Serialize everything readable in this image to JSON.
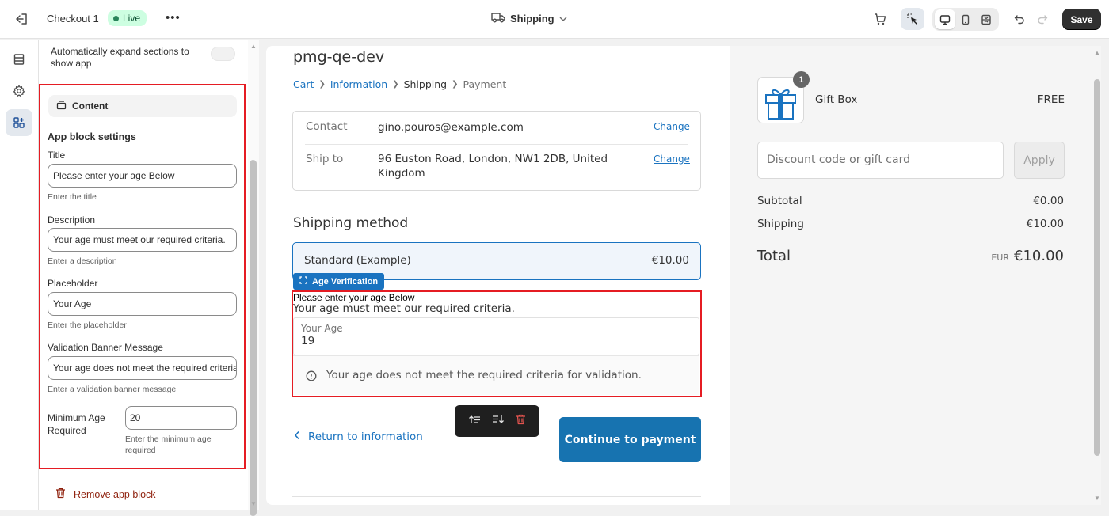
{
  "topbar": {
    "title": "Checkout 1",
    "status": "Live",
    "more": "•••",
    "page_selector": "Shipping",
    "save_label": "Save"
  },
  "panel": {
    "auto_expand_label": "Automatically expand sections to show app",
    "content_tab": "Content",
    "section_header": "App block settings",
    "fields": {
      "title": {
        "label": "Title",
        "value": "Please enter your age Below",
        "hint": "Enter the title"
      },
      "description": {
        "label": "Description",
        "value": "Your age must meet our required criteria.",
        "hint": "Enter a description"
      },
      "placeholder": {
        "label": "Placeholder",
        "value": "Your Age",
        "hint": "Enter the placeholder"
      },
      "validation": {
        "label": "Validation Banner Message",
        "value": "Your age does not meet the required criteria for validation.",
        "hint": "Enter a validation banner message"
      },
      "min_age": {
        "label": "Minimum Age Required",
        "value": "20",
        "hint": "Enter the minimum age required"
      }
    },
    "remove_label": "Remove app block"
  },
  "checkout": {
    "shop_name": "pmg-qe-dev",
    "breadcrumbs": [
      "Cart",
      "Information",
      "Shipping",
      "Payment"
    ],
    "review": {
      "contact_label": "Contact",
      "contact_value": "gino.pouros@example.com",
      "ship_label": "Ship to",
      "ship_value": "96 Euston Road, London, NW1 2DB, United Kingdom",
      "change": "Change"
    },
    "shipping_heading": "Shipping method",
    "shipping_option": {
      "name": "Standard (Example)",
      "price": "€10.00"
    },
    "app_badge": "Age Verification",
    "age_block": {
      "title": "Please enter your age Below",
      "description": "Your age must meet our required criteria.",
      "placeholder": "Your Age",
      "value": "19",
      "banner": "Your age does not meet the required criteria for validation."
    },
    "return_link": "Return to information",
    "continue_button": "Continue to payment"
  },
  "summary": {
    "item_name": "Gift Box",
    "item_price": "FREE",
    "item_qty": "1",
    "discount_placeholder": "Discount code or gift card",
    "apply_label": "Apply",
    "subtotal_label": "Subtotal",
    "subtotal_value": "€0.00",
    "shipping_label": "Shipping",
    "shipping_value": "€10.00",
    "total_label": "Total",
    "total_currency": "EUR",
    "total_value": "€10.00"
  },
  "colors": {
    "accent": "#1773b0",
    "highlight": "#e51c23",
    "live_bg": "#cdfee1"
  }
}
